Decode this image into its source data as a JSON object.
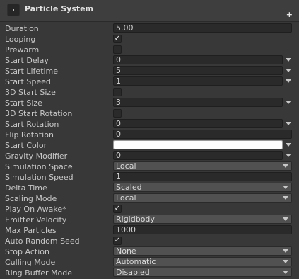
{
  "header": {
    "title": "Particle System",
    "add_glyph": "+"
  },
  "check_glyph": "✓",
  "rows": {
    "duration": {
      "label": "Duration",
      "value": "5.00"
    },
    "looping": {
      "label": "Looping",
      "checked": true
    },
    "prewarm": {
      "label": "Prewarm",
      "checked": false
    },
    "start_delay": {
      "label": "Start Delay",
      "value": "0"
    },
    "start_lifetime": {
      "label": "Start Lifetime",
      "value": "5"
    },
    "start_speed": {
      "label": "Start Speed",
      "value": "1"
    },
    "start_size_3d": {
      "label": "3D Start Size",
      "checked": false
    },
    "start_size": {
      "label": "Start Size",
      "value": "3"
    },
    "start_rotation_3d": {
      "label": "3D Start Rotation",
      "checked": false
    },
    "start_rotation": {
      "label": "Start Rotation",
      "value": "0"
    },
    "flip_rotation": {
      "label": "Flip Rotation",
      "value": "0"
    },
    "start_color": {
      "label": "Start Color",
      "color": "#ffffff"
    },
    "gravity_modifier": {
      "label": "Gravity Modifier",
      "value": "0"
    },
    "simulation_space": {
      "label": "Simulation Space",
      "value": "Local"
    },
    "simulation_speed": {
      "label": "Simulation Speed",
      "value": "1"
    },
    "delta_time": {
      "label": "Delta Time",
      "value": "Scaled"
    },
    "scaling_mode": {
      "label": "Scaling Mode",
      "value": "Local"
    },
    "play_on_awake": {
      "label": "Play On Awake*",
      "checked": true
    },
    "emitter_velocity": {
      "label": "Emitter Velocity",
      "value": "Rigidbody"
    },
    "max_particles": {
      "label": "Max Particles",
      "value": "1000"
    },
    "auto_random_seed": {
      "label": "Auto Random Seed",
      "checked": true
    },
    "stop_action": {
      "label": "Stop Action",
      "value": "None"
    },
    "culling_mode": {
      "label": "Culling Mode",
      "value": "Automatic"
    },
    "ring_buffer_mode": {
      "label": "Ring Buffer Mode",
      "value": "Disabled"
    }
  },
  "colors": {
    "panel_bg": "#383838",
    "field_bg": "#2a2a2a",
    "dropdown_bg": "#515151",
    "text": "#c8c8c8"
  }
}
